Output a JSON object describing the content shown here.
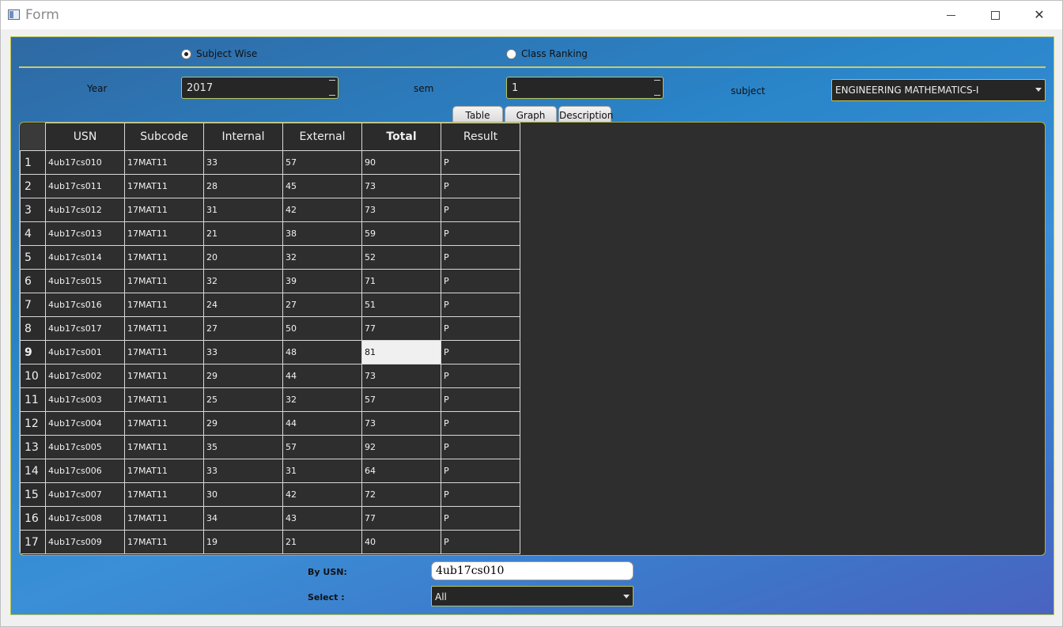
{
  "window": {
    "title": "Form",
    "minimize": "minimize",
    "maximize": "maximize",
    "close": "close"
  },
  "mode": {
    "options": [
      {
        "label": "Subject Wise",
        "selected": true
      },
      {
        "label": "Class Ranking",
        "selected": false
      }
    ]
  },
  "filters": {
    "year_label": "Year",
    "year_value": "2017",
    "sem_label": "sem",
    "sem_value": "1",
    "subject_label": "subject",
    "subject_value": "ENGINEERING MATHEMATICS-I"
  },
  "tabs": [
    "Table",
    "Graph",
    "Description"
  ],
  "active_tab": "Table",
  "table": {
    "columns": [
      "USN",
      "Subcode",
      "Internal",
      "External",
      "Total",
      "Result"
    ],
    "bold_column": "Total",
    "selected_row": 9,
    "selected_column": "Total",
    "rows": [
      {
        "n": "1",
        "usn": "4ub17cs010",
        "sub": "17MAT11",
        "int": "33",
        "ext": "57",
        "tot": "90",
        "res": "P"
      },
      {
        "n": "2",
        "usn": "4ub17cs011",
        "sub": "17MAT11",
        "int": "28",
        "ext": "45",
        "tot": "73",
        "res": "P"
      },
      {
        "n": "3",
        "usn": "4ub17cs012",
        "sub": "17MAT11",
        "int": "31",
        "ext": "42",
        "tot": "73",
        "res": "P"
      },
      {
        "n": "4",
        "usn": "4ub17cs013",
        "sub": "17MAT11",
        "int": "21",
        "ext": "38",
        "tot": "59",
        "res": "P"
      },
      {
        "n": "5",
        "usn": "4ub17cs014",
        "sub": "17MAT11",
        "int": "20",
        "ext": "32",
        "tot": "52",
        "res": "P"
      },
      {
        "n": "6",
        "usn": "4ub17cs015",
        "sub": "17MAT11",
        "int": "32",
        "ext": "39",
        "tot": "71",
        "res": "P"
      },
      {
        "n": "7",
        "usn": "4ub17cs016",
        "sub": "17MAT11",
        "int": "24",
        "ext": "27",
        "tot": "51",
        "res": "P"
      },
      {
        "n": "8",
        "usn": "4ub17cs017",
        "sub": "17MAT11",
        "int": "27",
        "ext": "50",
        "tot": "77",
        "res": "P"
      },
      {
        "n": "9",
        "usn": "4ub17cs001",
        "sub": "17MAT11",
        "int": "33",
        "ext": "48",
        "tot": "81",
        "res": "P"
      },
      {
        "n": "10",
        "usn": "4ub17cs002",
        "sub": "17MAT11",
        "int": "29",
        "ext": "44",
        "tot": "73",
        "res": "P"
      },
      {
        "n": "11",
        "usn": "4ub17cs003",
        "sub": "17MAT11",
        "int": "25",
        "ext": "32",
        "tot": "57",
        "res": "P"
      },
      {
        "n": "12",
        "usn": "4ub17cs004",
        "sub": "17MAT11",
        "int": "29",
        "ext": "44",
        "tot": "73",
        "res": "P"
      },
      {
        "n": "13",
        "usn": "4ub17cs005",
        "sub": "17MAT11",
        "int": "35",
        "ext": "57",
        "tot": "92",
        "res": "P"
      },
      {
        "n": "14",
        "usn": "4ub17cs006",
        "sub": "17MAT11",
        "int": "33",
        "ext": "31",
        "tot": "64",
        "res": "P"
      },
      {
        "n": "15",
        "usn": "4ub17cs007",
        "sub": "17MAT11",
        "int": "30",
        "ext": "42",
        "tot": "72",
        "res": "P"
      },
      {
        "n": "16",
        "usn": "4ub17cs008",
        "sub": "17MAT11",
        "int": "34",
        "ext": "43",
        "tot": "77",
        "res": "P"
      },
      {
        "n": "17",
        "usn": "4ub17cs009",
        "sub": "17MAT11",
        "int": "19",
        "ext": "21",
        "tot": "40",
        "res": "P"
      }
    ]
  },
  "bottom": {
    "usn_label": "By USN:",
    "usn_value": "4ub17cs010",
    "select_label": "Select :",
    "select_value": "All"
  }
}
